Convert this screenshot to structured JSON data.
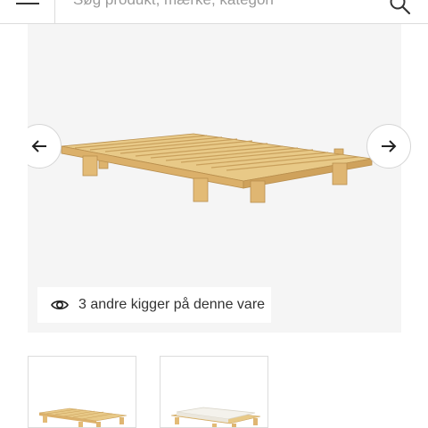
{
  "header": {
    "menu_icon": "hamburger-menu-icon",
    "search_placeholder": "Søg produkt, mærke, kategori",
    "search_icon": "search-icon"
  },
  "gallery": {
    "prev_icon": "arrow-left-icon",
    "next_icon": "arrow-right-icon",
    "viewers_icon": "eye-icon",
    "viewers_text": "3 andre kigger på denne vare"
  },
  "thumbnails": [
    {
      "name": "bed-frame-pine"
    },
    {
      "name": "bed-frame-with-mattress"
    }
  ],
  "colors": {
    "wood": "#e8c987",
    "wood_dark": "#c9a05c",
    "gallery_bg": "#f5f5f5",
    "mattress": "#f4f2ec"
  }
}
